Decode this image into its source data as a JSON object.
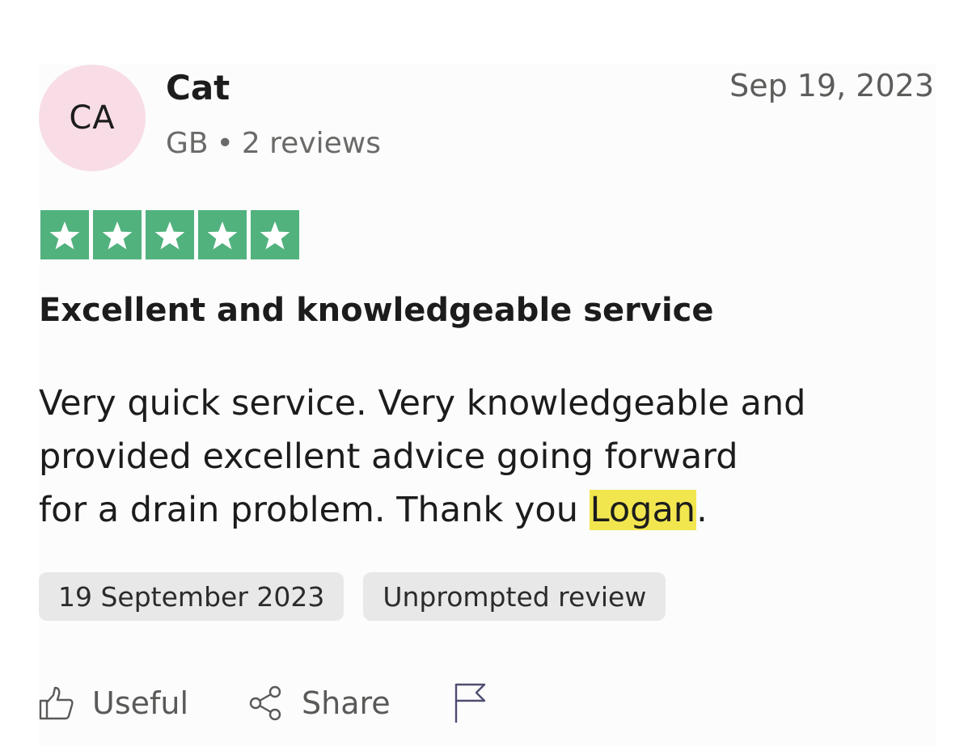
{
  "review": {
    "avatar_initials": "CA",
    "reviewer_name": "Cat",
    "country": "GB",
    "separator": "•",
    "review_count": "2 reviews",
    "date": "Sep 19, 2023",
    "rating": 5,
    "rating_max": 5,
    "star_color": "#51b27e",
    "title": "Excellent and knowledgeable service",
    "body_lines": [
      "Very quick service. Very knowledgeable and",
      "provided excellent advice going forward",
      "for a drain problem. Thank you "
    ],
    "body_highlight": "Logan",
    "body_end": ".",
    "highlight_color": "#f2e64f",
    "tags": [
      "19 September 2023",
      "Unprompted review"
    ]
  },
  "actions": {
    "useful_label": "Useful",
    "share_label": "Share",
    "useful_icon": "thumbs-up-icon",
    "share_icon": "share-icon",
    "flag_icon": "flag-icon"
  }
}
